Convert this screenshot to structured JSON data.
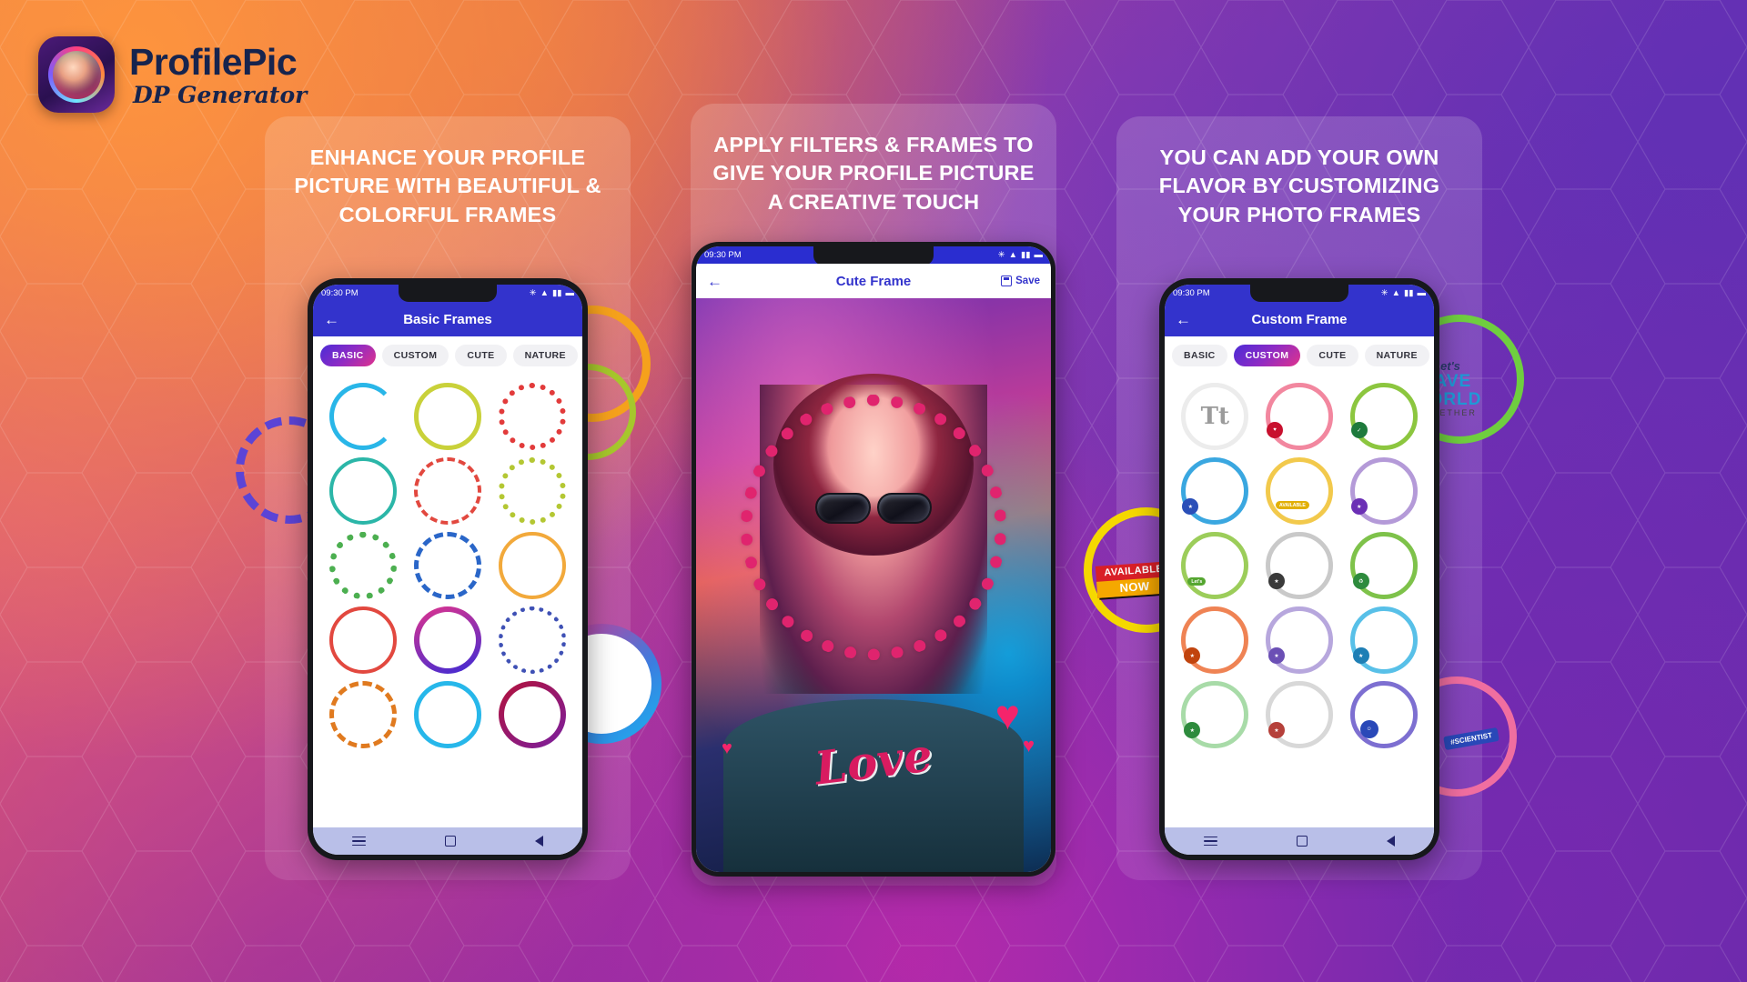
{
  "brand": {
    "title": "ProfilePic",
    "subtitle": "DP Generator",
    "icon": "app-logo-avatar"
  },
  "colors": {
    "accent_blue": "#3333cc",
    "tab_active_gradient_start": "#4b2bd6",
    "tab_active_gradient_end": "#e0338c",
    "love_pink": "#d81b60",
    "badge_red": "#d91f27",
    "badge_yellow": "#f5a800"
  },
  "panels": [
    {
      "headline": "ENHANCE YOUR PROFILE PICTURE WITH BEAUTIFUL & COLORFUL FRAMES",
      "phone": {
        "status": {
          "time": "09:30 PM",
          "icons": [
            "bluetooth-icon",
            "wifi-icon",
            "signal-icon",
            "battery-icon"
          ]
        },
        "appbar": {
          "back": "←",
          "title": "Basic Frames"
        },
        "tabs": [
          {
            "label": "BASIC",
            "active": true
          },
          {
            "label": "CUSTOM",
            "active": false
          },
          {
            "label": "CUTE",
            "active": false
          },
          {
            "label": "NATURE",
            "active": false
          }
        ],
        "nav": [
          "menu-icon",
          "home-square-icon",
          "back-triangle-icon"
        ]
      }
    },
    {
      "headline": "APPLY FILTERS & FRAMES TO GIVE YOUR PROFILE PICTURE A CREATIVE TOUCH",
      "phone": {
        "status": {
          "time": "09:30 PM",
          "icons": [
            "bluetooth-icon",
            "wifi-icon",
            "signal-icon",
            "battery-icon"
          ]
        },
        "appbar": {
          "back": "←",
          "title": "Cute Frame",
          "save": "Save"
        },
        "overlay": {
          "word": "Love"
        }
      }
    },
    {
      "headline": "YOU CAN ADD YOUR OWN FLAVOR BY CUSTOMIZING YOUR PHOTO FRAMES",
      "phone": {
        "status": {
          "time": "09:30 PM",
          "icons": [
            "bluetooth-icon",
            "wifi-icon",
            "signal-icon",
            "battery-icon"
          ]
        },
        "appbar": {
          "back": "←",
          "title": "Custom Frame"
        },
        "tabs": [
          {
            "label": "BASIC",
            "active": false
          },
          {
            "label": "CUSTOM",
            "active": true
          },
          {
            "label": "CUTE",
            "active": false
          },
          {
            "label": "NATURE",
            "active": false
          }
        ],
        "text_tool_icon": "Tt",
        "nav": [
          "menu-icon",
          "home-square-icon",
          "back-triangle-icon"
        ]
      }
    }
  ],
  "decorations": {
    "available_badge": {
      "line1": "AVAILABLE",
      "line2": "NOW"
    },
    "save_world": {
      "l1": "Let's",
      "l2": "SAVE",
      "l3": "WORLD",
      "l4": "TOGETHER"
    },
    "scientist_tag": "#SCIENTIST"
  }
}
